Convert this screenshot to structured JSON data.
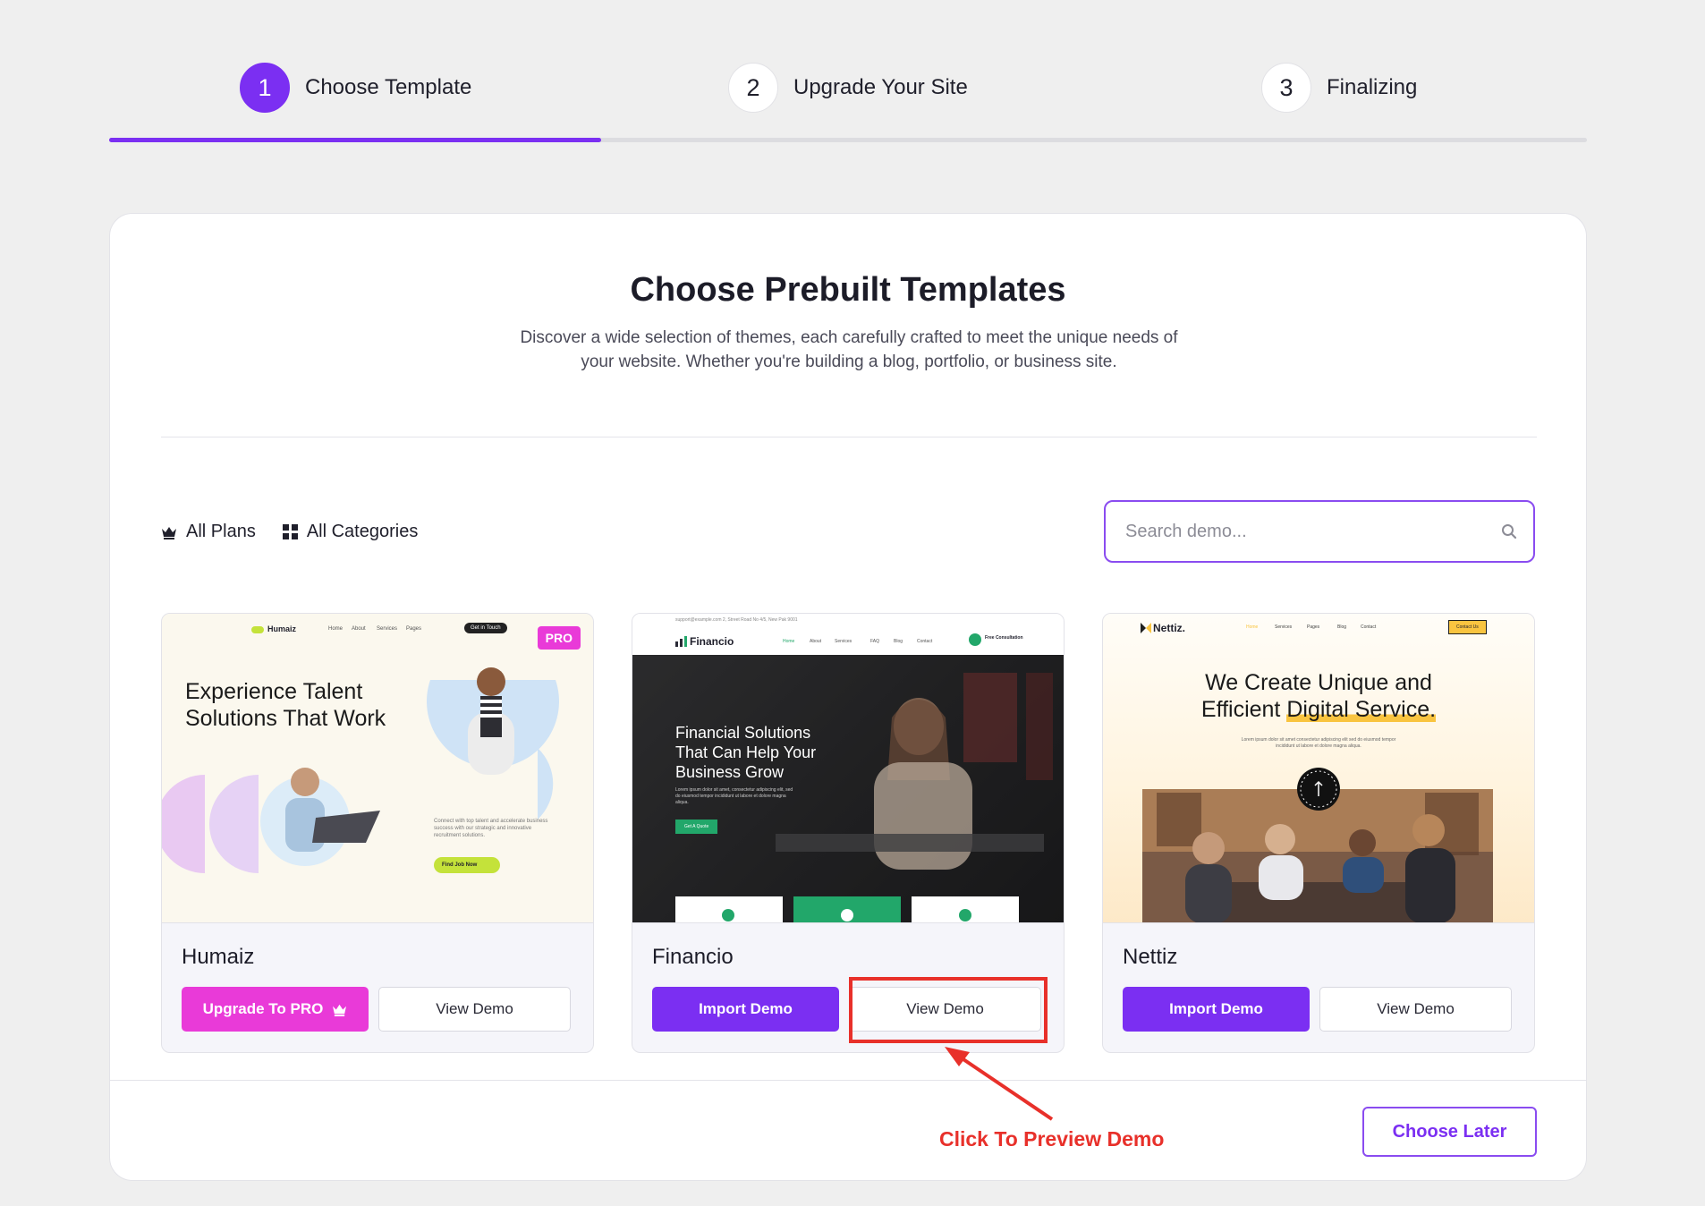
{
  "stepper": {
    "steps": [
      {
        "number": "1",
        "label": "Choose Template",
        "active": true
      },
      {
        "number": "2",
        "label": "Upgrade Your Site",
        "active": false
      },
      {
        "number": "3",
        "label": "Finalizing",
        "active": false
      }
    ],
    "progress": 0.333
  },
  "header": {
    "title": "Choose Prebuilt Templates",
    "description": "Discover a wide selection of themes, each carefully crafted to meet the unique needs of your website. Whether you're building a blog, portfolio, or business site."
  },
  "filters": {
    "plans_label": "All Plans",
    "categories_label": "All Categories"
  },
  "search": {
    "placeholder": "Search demo..."
  },
  "templates": [
    {
      "name": "Humaiz",
      "badge": "PRO",
      "primary_label": "Upgrade To PRO",
      "secondary_label": "View Demo",
      "preview": {
        "logo": "Humaiz",
        "nav": [
          "Home",
          "About",
          "Services",
          "Pages"
        ],
        "cta": "Get in Touch",
        "headline_line1": "Experience Talent",
        "headline_line2": "Solutions That Work",
        "body": "Connect with top talent and accelerate business success with our strategic and innovative recruitment solutions.",
        "button": "Find Job Now"
      }
    },
    {
      "name": "Financio",
      "primary_label": "Import Demo",
      "secondary_label": "View Demo",
      "preview": {
        "logo": "Financio",
        "topbar": "support@example.com   2, Street Road No 4/5, New Pak 9001",
        "nav": [
          "Home",
          "About",
          "Services",
          "FAQ",
          "Blog",
          "Contact"
        ],
        "consult": "Free Consultation",
        "headline_line1": "Financial Solutions",
        "headline_line2": "That Can Help Your",
        "headline_line3": "Business Grow",
        "body": "Lorem ipsum dolor sit amet, consectetur adipiscing elit, sed do eiusmod tempor incididunt ut labore et dolore magna aliqua.",
        "button": "Get A Quote"
      }
    },
    {
      "name": "Nettiz",
      "primary_label": "Import Demo",
      "secondary_label": "View Demo",
      "preview": {
        "logo": "Nettiz.",
        "nav": [
          "Home",
          "Services",
          "Pages",
          "Blog",
          "Contact"
        ],
        "cta": "Contact Us",
        "headline_line1": "We Create Unique and",
        "headline_line2a": "Efficient ",
        "headline_line2b": "Digital Service.",
        "body": "Lorem ipsum dolor sit amet consectetur adipiscing elit sed do eiusmod tempor incididunt ut labore et dolore magna aliqua."
      }
    }
  ],
  "footer": {
    "choose_later_label": "Choose Later"
  },
  "annotation": {
    "text": "Click To Preview Demo"
  },
  "colors": {
    "accent": "#7b2ff2",
    "pro": "#e93ad8",
    "annotation": "#e8302a",
    "nettiz_highlight": "#f9c440",
    "financio_green": "#22a76a"
  },
  "icons": [
    "crown-icon",
    "grid-icon",
    "search-icon",
    "arrow-icon"
  ]
}
